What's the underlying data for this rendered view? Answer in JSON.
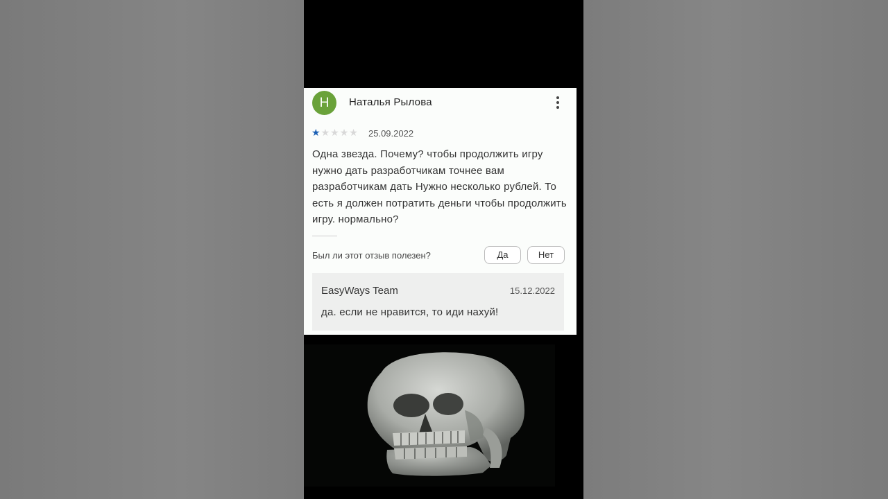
{
  "review": {
    "avatar_letter": "Н",
    "reviewer_name": "Наталья Рылова",
    "rating": 1,
    "rating_max": 5,
    "date": "25.09.2022",
    "text": "Одна звезда. Почему? чтобы продолжить игру нужно дать разработчикам точнее вам разработчикам дать Нужно несколько рублей. То есть я должен потратить деньги чтобы продолжить игру. нормально?",
    "helpful_question": "Был ли этот отзыв полезен?",
    "yes_label": "Да",
    "no_label": "Нет"
  },
  "reply": {
    "author": "EasyWays Team",
    "date": "15.12.2022",
    "text": "да. если не нравится, то иди нахуй!"
  },
  "colors": {
    "avatar": "#6aa23a",
    "star_active": "#1a5fb4",
    "card_bg": "#fbfdfb",
    "reply_bg": "#eeefee"
  },
  "icons": {
    "menu": "more-vert-icon",
    "rating": "star-icon"
  }
}
